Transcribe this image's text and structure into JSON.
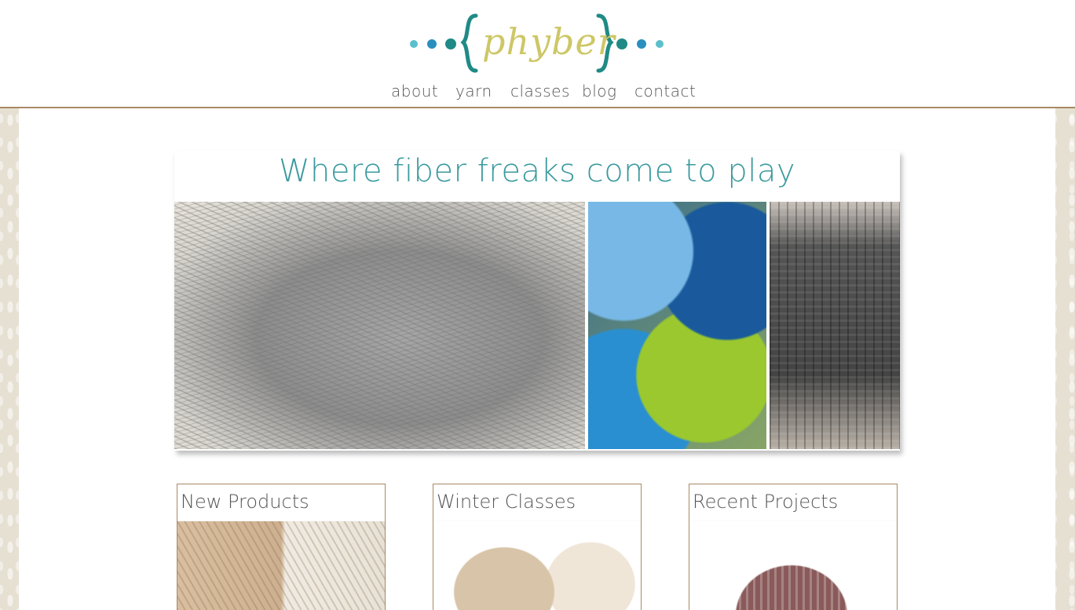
{
  "header": {
    "logo_text": "phyber",
    "nav": [
      {
        "label": "about"
      },
      {
        "label": "yarn"
      },
      {
        "label": "classes"
      },
      {
        "label": "blog"
      },
      {
        "label": "contact"
      }
    ]
  },
  "hero": {
    "title": "Where fiber freaks come to play",
    "images": [
      "grey-yarn-photo",
      "yarn-balls-photo",
      "knit-hat-photo"
    ]
  },
  "cards": [
    {
      "title": "New Products"
    },
    {
      "title": "Winter Classes"
    },
    {
      "title": "Recent Projects"
    }
  ],
  "colors": {
    "accent_teal": "#3a9a9e",
    "logo_yellow": "#cdc766",
    "border_brown": "#a88965",
    "dot_light_blue": "#5bc0cc",
    "dot_blue": "#2a8fbf",
    "dot_dark_teal": "#1f8a86"
  }
}
